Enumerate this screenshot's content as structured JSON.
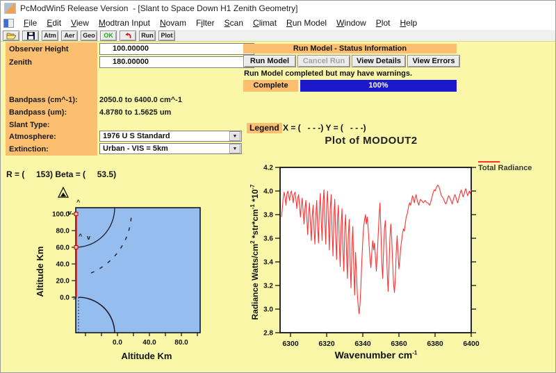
{
  "window": {
    "title": "PcModWin5 Release Version  - [Slant to Space Down H1 Zenith Geometry]"
  },
  "menu": {
    "items": [
      {
        "label": "File",
        "mnemonic": 0
      },
      {
        "label": "Edit",
        "mnemonic": 0
      },
      {
        "label": "View",
        "mnemonic": 0
      },
      {
        "label": "Modtran Input",
        "mnemonic": 0
      },
      {
        "label": "Novam",
        "mnemonic": 0
      },
      {
        "label": "Filter",
        "mnemonic": 1
      },
      {
        "label": "Scan",
        "mnemonic": 0
      },
      {
        "label": "Climat",
        "mnemonic": 0
      },
      {
        "label": "Run Model",
        "mnemonic": 0
      },
      {
        "label": "Window",
        "mnemonic": 0
      },
      {
        "label": "Plot",
        "mnemonic": 0
      },
      {
        "label": "Help",
        "mnemonic": 0
      }
    ]
  },
  "toolbar": {
    "atm_label": "Atm",
    "aer_label": "Aer",
    "geo_label": "Geo",
    "ok_label": "OK",
    "run_label": "Run",
    "plot_label": "Plot"
  },
  "form": {
    "observer_height": {
      "label": "Observer Height",
      "value": "100.00000"
    },
    "zenith": {
      "label": "Zenith",
      "value": "180.00000"
    },
    "bandpass_cm": {
      "label": "Bandpass (cm^-1):",
      "value": "2050.0 to 6400.0 cm^-1"
    },
    "bandpass_um": {
      "label": "Bandpass (um):",
      "value": "4.8780 to 1.5625 um"
    },
    "slant_type": {
      "label": "Slant Type:",
      "value": ""
    },
    "atmosphere": {
      "label": "Atmosphere:",
      "value": "1976 U S Standard"
    },
    "extinction": {
      "label": "Extinction:",
      "value": "Urban - VIS = 5km"
    }
  },
  "status_panel": {
    "header": "Run Model - Status Information",
    "run_model_button": "Run Model",
    "cancel_run_button": "Cancel Run",
    "view_details_button": "View Details",
    "view_errors_button": "View Errors",
    "status_message": "Run Model completed but may have warnings.",
    "complete_label": "Complete",
    "progress_percent": "100%"
  },
  "legend_bar": {
    "legend_label": "Legend",
    "xy_text": "X = (   - - -) Y = (   - - -)"
  },
  "r_beta_text": "R = (     153) Beta = (     53.5)",
  "spectrum_labels": {
    "ylabel_main": "Radiance Watts/cm",
    "ylabel_sup1": "2",
    "ylabel_mid": " *str*cm",
    "ylabel_sup2": "-1",
    "ylabel_mul": "  *10",
    "ylabel_sup3": "-7",
    "xlabel_main": "Wavenumber cm",
    "xlabel_sup": "-1"
  },
  "colors": {
    "background_yellow": "#FAF7A8",
    "accent_orange": "#FBBF6F",
    "plot_blue": "#95BDEE",
    "progress_blue": "#1A1ACC",
    "curve_red": "#FF3030",
    "path_red": "#E81010"
  },
  "chart_data": [
    {
      "type": "line",
      "name": "slant-geometry-plot",
      "xlabel": "Altitude Km",
      "ylabel": "Altitude Km",
      "x_ticks": [
        0.0,
        40.0,
        80.0
      ],
      "x_minor_ticks": [
        -40,
        -20,
        0,
        20,
        40,
        60,
        80,
        100
      ],
      "y_ticks": [
        0.0,
        20.0,
        40.0,
        60.0,
        80.0,
        100.0
      ],
      "xlim": [
        -52,
        103
      ],
      "ylim": [
        -45,
        107
      ],
      "r_value": 153,
      "beta_value": 53.5,
      "path_nodes_km": [
        100,
        60,
        0
      ],
      "description": "Slant path geometry: red observer path along left axis from 100 km down to 0 km with node squares at 100 km and 60 km; solid arcs mark the 60 km layer top and the earth surface; dashed fan arc marks the slant line-of-sight.",
      "markers": [
        {
          "glyph": "^",
          "x": 69,
          "y": 31
        },
        {
          "glyph": "v",
          "x": 57,
          "y": 46
        },
        {
          "glyph": "^",
          "x": 72,
          "y": 80
        },
        {
          "glyph": "v",
          "x": 84,
          "y": 82
        },
        {
          "glyph": ">",
          "x": 64,
          "y": 169
        }
      ]
    },
    {
      "type": "line",
      "name": "spectrum-plot",
      "title": "Plot of MODOUT2",
      "series_name": "Total Radiance",
      "xlabel": "Wavenumber cm-1",
      "ylabel": "Radiance Watts/cm^2*str*cm^-1 *10^-7",
      "xlim": [
        6295,
        6400
      ],
      "ylim": [
        2.8,
        4.2
      ],
      "x_ticks": [
        6300,
        6320,
        6340,
        6360,
        6380,
        6400
      ],
      "y_ticks": [
        2.8,
        3.0,
        3.2,
        3.4,
        3.6,
        3.8,
        4.0,
        4.2
      ],
      "legend_position": "top-right",
      "x_start": 6295,
      "x_step": 0.5,
      "y": [
        3.78,
        3.86,
        3.95,
        3.99,
        3.94,
        3.88,
        3.97,
        4.0,
        3.96,
        3.92,
        3.98,
        4.0,
        3.95,
        3.9,
        3.97,
        3.99,
        3.93,
        3.85,
        3.94,
        3.97,
        3.87,
        3.78,
        3.88,
        3.94,
        3.82,
        3.72,
        3.85,
        3.92,
        3.78,
        3.63,
        3.8,
        3.9,
        3.72,
        3.58,
        3.78,
        3.88,
        3.68,
        3.55,
        3.8,
        3.92,
        3.7,
        3.56,
        3.85,
        3.98,
        3.74,
        3.58,
        3.9,
        4.01,
        3.76,
        3.55,
        3.88,
        4.0,
        3.72,
        3.5,
        3.85,
        3.97,
        3.66,
        3.45,
        3.8,
        3.93,
        3.62,
        3.42,
        3.76,
        3.88,
        3.56,
        3.36,
        3.72,
        3.85,
        3.52,
        3.32,
        3.68,
        3.8,
        3.46,
        3.26,
        3.62,
        3.76,
        3.4,
        3.18,
        3.55,
        3.7,
        3.35,
        3.12,
        3.48,
        3.3,
        3.12,
        3.02,
        2.96,
        3.05,
        3.22,
        3.42,
        3.58,
        3.7,
        3.76,
        3.8,
        3.72,
        3.78,
        3.68,
        3.55,
        3.42,
        3.35,
        3.48,
        3.58,
        3.5,
        3.56,
        3.44,
        3.32,
        3.46,
        3.62,
        3.78,
        3.9,
        3.68,
        3.4,
        3.26,
        3.5,
        3.68,
        3.75,
        3.55,
        3.32,
        3.15,
        3.35,
        3.6,
        3.72,
        3.6,
        3.4,
        3.22,
        3.14,
        3.25,
        3.48,
        3.62,
        3.48,
        3.34,
        3.42,
        3.52,
        3.58,
        3.64,
        3.68,
        3.66,
        3.72,
        3.78,
        3.8,
        3.84,
        3.88,
        3.9,
        3.88,
        3.92,
        3.96,
        3.94,
        3.9,
        3.94,
        3.97,
        3.93,
        3.9,
        3.88,
        3.91,
        3.93,
        3.92,
        3.91,
        3.9,
        3.91,
        3.92,
        3.91,
        3.9,
        3.9,
        3.89,
        3.88,
        3.9,
        3.93,
        3.96,
        3.99,
        4.01,
        4.0,
        4.02,
        4.04,
        4.05,
        4.04,
        4.02,
        3.99,
        3.96,
        3.95,
        3.94,
        3.92,
        3.9,
        3.89,
        3.91,
        3.94,
        3.96,
        3.95,
        3.93,
        3.91,
        3.89,
        3.92,
        3.95,
        3.97,
        3.95,
        3.92,
        3.9,
        3.93,
        3.96,
        3.99,
        4.01,
        3.98,
        3.95,
        3.97,
        4.0,
        4.02,
        3.99,
        3.96,
        3.98,
        4.0,
        3.98,
        4.01
      ]
    }
  ]
}
